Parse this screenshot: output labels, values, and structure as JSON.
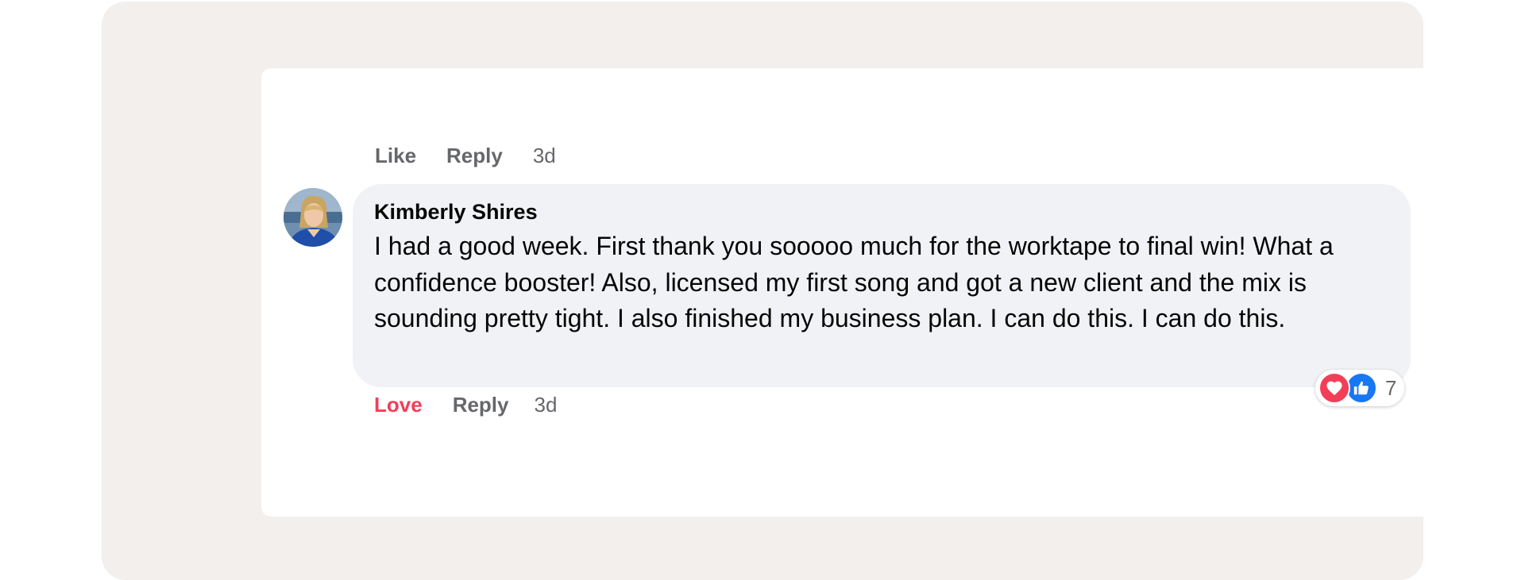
{
  "previous_comment": {
    "like_label": "Like",
    "reply_label": "Reply",
    "timestamp": "3d"
  },
  "comment": {
    "author": "Kimberly Shires",
    "text": "I had a good week. First thank you sooooo much for the worktape to final win! What a confidence booster! Also, licensed my first song and got a new client and the mix is sounding pretty tight. I also finished my business plan. I can do this. I can do this.",
    "reaction_count": "7",
    "reaction_icons": [
      "love-icon",
      "like-icon"
    ],
    "love_label": "Love",
    "reply_label": "Reply",
    "timestamp": "3d"
  },
  "colors": {
    "love": "#f33e58",
    "like": "#1877f2",
    "bubble": "#f0f2f5",
    "frame": "#f2efed",
    "secondary_text": "#65676b"
  }
}
